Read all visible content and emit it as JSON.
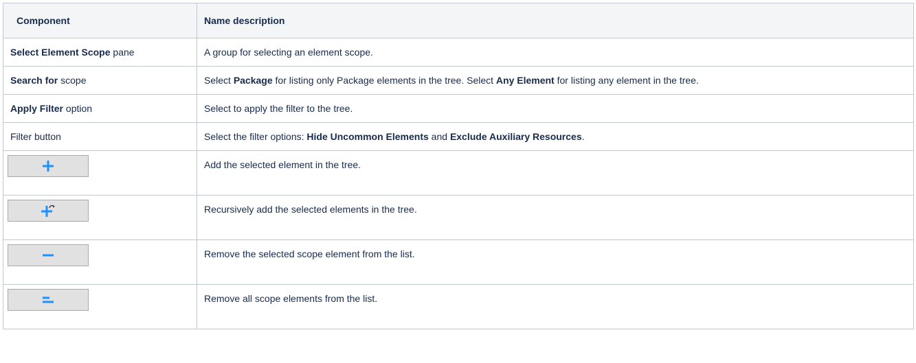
{
  "headers": {
    "component": "Component",
    "description": "Name description"
  },
  "rows": [
    {
      "component_bold": "Select Element Scope",
      "component_rest": " pane",
      "description": "A group for selecting an element scope."
    },
    {
      "component_bold": "Search for",
      "component_rest": " scope",
      "desc_1": "Select ",
      "desc_2": "Package",
      "desc_3": " for listing only Package elements in the tree. Select ",
      "desc_4": "Any Element",
      "desc_5": " for listing any element in the tree."
    },
    {
      "component_bold": "Apply Filter",
      "component_rest": " option",
      "description": "Select to apply the filter to the tree."
    },
    {
      "component": "Filter button",
      "desc_1": "Select the filter options: ",
      "desc_2": "Hide Uncommon Elements",
      "desc_3": " and ",
      "desc_4": "Exclude Auxiliary Resources",
      "desc_5": "."
    },
    {
      "icon": "plus-icon",
      "description": "Add the selected element in the tree."
    },
    {
      "icon": "recursive-add-icon",
      "description": "Recursively add the selected elements in the tree."
    },
    {
      "icon": "minus-icon",
      "description": "Remove the selected scope element from the list."
    },
    {
      "icon": "remove-all-icon",
      "description": "Remove all scope elements from the list."
    }
  ],
  "colors": {
    "icon_blue": "#1e90ff",
    "header_bg": "#f4f5f7",
    "border": "#c1c7d0",
    "button_bg": "#e1e1e1"
  }
}
